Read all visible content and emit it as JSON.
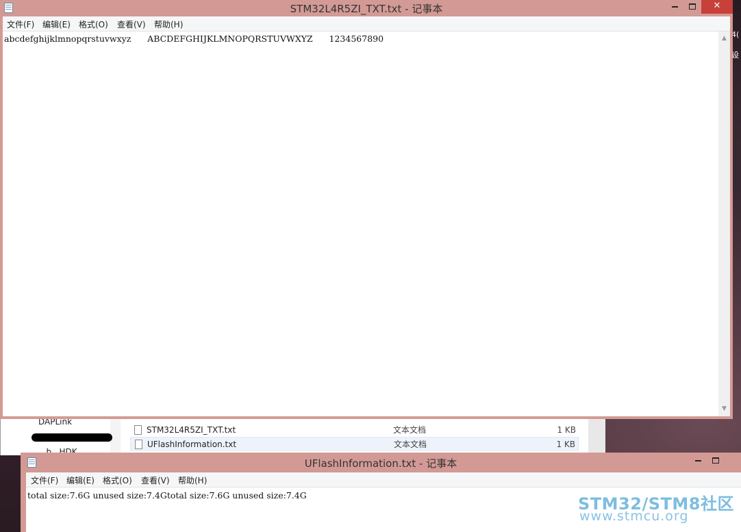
{
  "desktop": {
    "right_edge_text": [
      "4(",
      "设"
    ]
  },
  "explorer": {
    "nav_items": [
      "DAPLink",
      "...",
      "...b...HDK"
    ],
    "files": [
      {
        "name": "STM32L4R5ZI_TXT.txt",
        "type": "文本文档",
        "size": "1 KB"
      },
      {
        "name": "UFlashInformation.txt",
        "type": "文本文档",
        "size": "1 KB"
      }
    ]
  },
  "notepad_main": {
    "title": "STM32L4R5ZI_TXT.txt - 记事本",
    "menu": [
      "文件(F)",
      "编辑(E)",
      "格式(O)",
      "查看(V)",
      "帮助(H)"
    ],
    "content": "abcdefghijklmnopqrstuvwxyz      ABCDEFGHIJKLMNOPQRSTUVWXYZ      1234567890",
    "controls": {
      "minimize": "–",
      "maximize": "□",
      "close": "✕"
    }
  },
  "notepad_second": {
    "title": "UFlashInformation.txt - 记事本",
    "menu": [
      "文件(F)",
      "编辑(E)",
      "格式(O)",
      "查看(V)",
      "帮助(H)"
    ],
    "content": "total size:7.6G unused size:7.4Gtotal size:7.6G unused size:7.4G"
  },
  "watermark": {
    "line1": "STM32/STM8社区",
    "line2": "www.stmcu.org"
  },
  "colors": {
    "titlebar_active": "#d39a95",
    "close_button": "#c7403a",
    "watermark": "#5aaad7"
  },
  "icons": {
    "app_icon": "notepad-icon",
    "file_icon": "text-file-icon",
    "close": "close-icon",
    "minimize": "minimize-icon",
    "maximize": "maximize-icon",
    "scroll_up": "chevron-up-icon",
    "scroll_down": "chevron-down-icon"
  }
}
